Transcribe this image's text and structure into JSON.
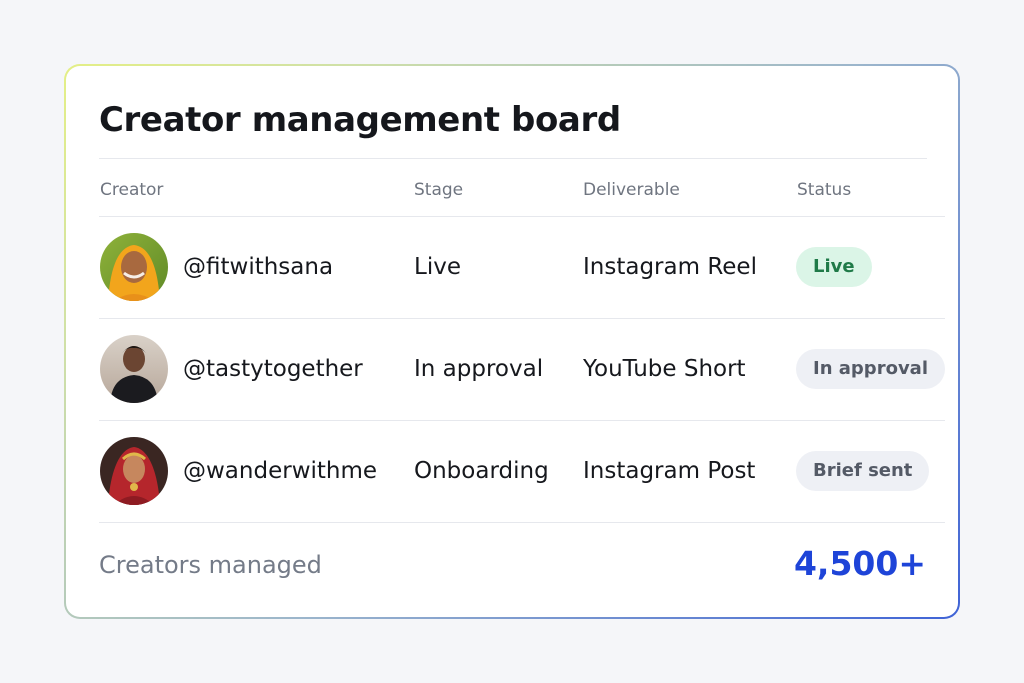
{
  "board": {
    "title": "Creator management board",
    "columns": {
      "creator": "Creator",
      "stage": "Stage",
      "deliverable": "Deliverable",
      "status": "Status"
    },
    "rows": [
      {
        "handle": "@fitwithsana",
        "stage": "Live",
        "deliverable": "Instagram Reel",
        "status": "Live",
        "status_tone": "success"
      },
      {
        "handle": "@tastytogether",
        "stage": "In approval",
        "deliverable": "YouTube Short",
        "status": "In approval",
        "status_tone": "neutral"
      },
      {
        "handle": "@wanderwithme",
        "stage": "Onboarding",
        "deliverable": "Instagram Post",
        "status": "Brief sent",
        "status_tone": "neutral"
      }
    ],
    "footer": {
      "label": "Creators managed",
      "value": "4,500+"
    }
  },
  "colors": {
    "page_background": "#f5f6f9",
    "accent_value": "#1e44d8",
    "live_badge_bg": "#dbf5e7",
    "live_badge_text": "#1f7a48",
    "neutral_badge_bg": "#eef0f5",
    "neutral_badge_text": "#545a66"
  }
}
